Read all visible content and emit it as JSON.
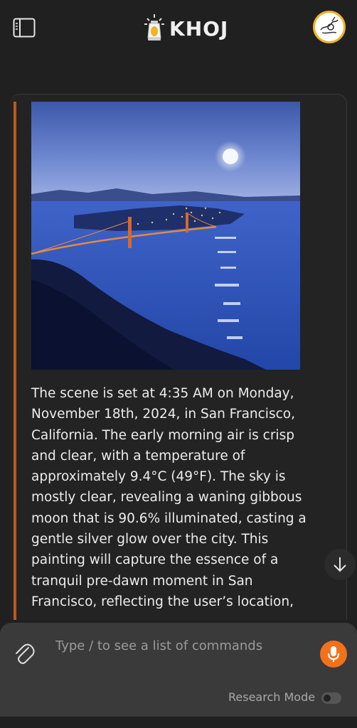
{
  "header": {
    "logo_text": "KHOJ",
    "sidebar_icon": "sidebar-panel-icon",
    "avatar_icon": "user-avatar-icon",
    "accent_color": "#f0b323"
  },
  "message": {
    "image_alt": "Painting of San Francisco bay and Golden Gate Bridge under a pre-dawn moon",
    "text": "The scene is set at 4:35 AM on Monday, November 18th, 2024, in San Francisco, California. The early morning air is crisp and clear, with a temperature of approximately 9.4°C (49°F). The sky is mostly clear, revealing a waning gibbous moon that is 90.6% illuminated, casting a gentle silver glow over the city. This painting will capture the essence of a tranquil pre-dawn moment in San Francisco, reflecting the user’s location,",
    "accent_color": "#b85a1e"
  },
  "input": {
    "placeholder": "Type / to see a list of commands",
    "value": "",
    "research_mode_label": "Research Mode",
    "research_mode_on": false,
    "mic_color": "#f2711c"
  }
}
